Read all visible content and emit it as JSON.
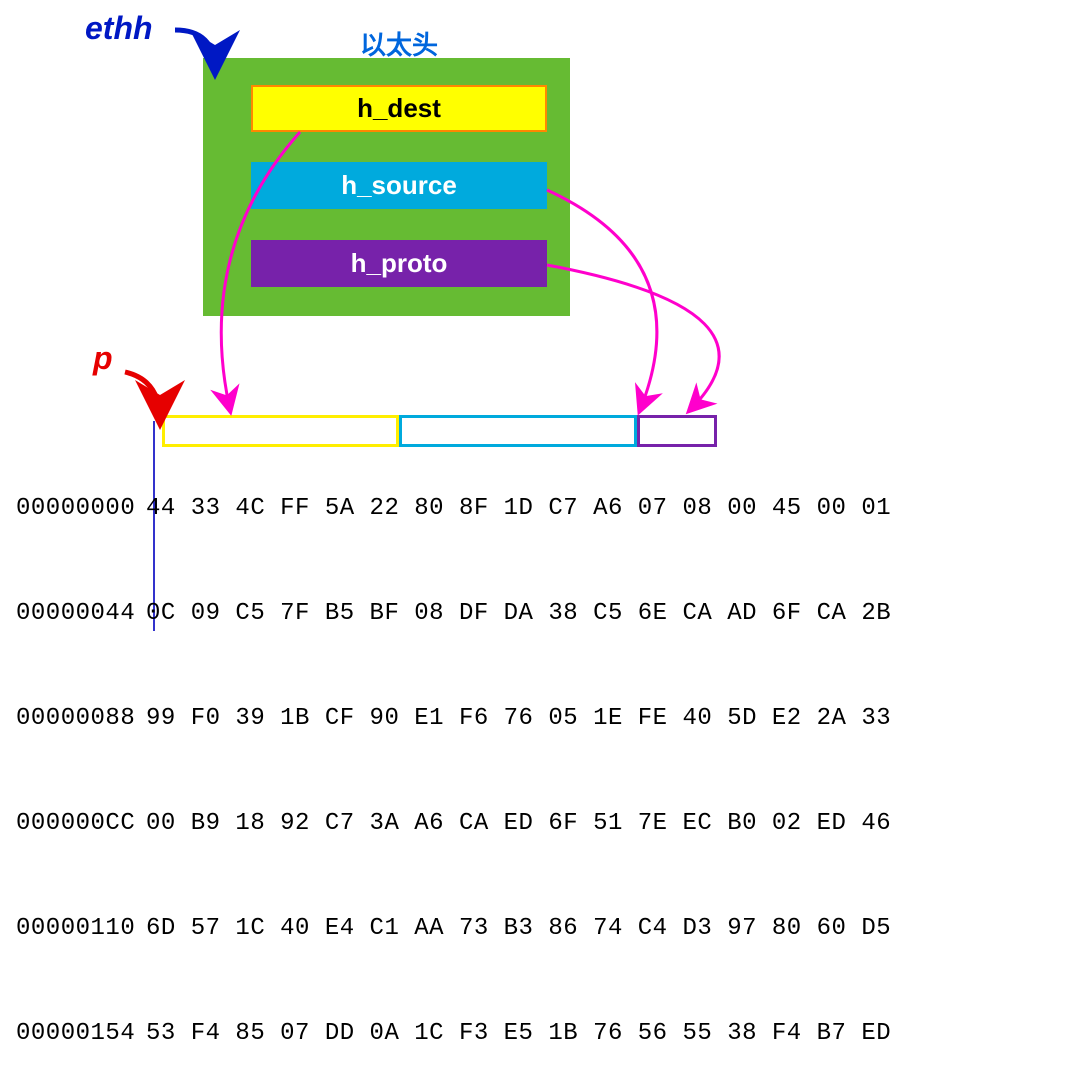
{
  "labels": {
    "ethh": "ethh",
    "p": "p",
    "title": "以太头"
  },
  "fields": {
    "dest": "h_dest",
    "source": "h_source",
    "proto": "h_proto"
  },
  "hexdump": {
    "offsets": [
      "00000000",
      "00000044",
      "00000088",
      "000000CC",
      "00000110",
      "00000154"
    ],
    "rows": [
      "44 33 4C FF 5A 22 80 8F 1D C7 A6 07 08 00 45 00 01",
      "0C 09 C5 7F B5 BF 08 DF DA 38 C5 6E CA AD 6F CA 2B",
      "99 F0 39 1B CF 90 E1 F6 76 05 1E FE 40 5D E2 2A 33",
      "00 B9 18 92 C7 3A A6 CA ED 6F 51 7E EC B0 02 ED 46",
      "6D 57 1C 40 E4 C1 AA 73 B3 86 74 C4 D3 97 80 60 D5",
      "53 F4 85 07 DD 0A 1C F3 E5 1B 76 56 55 38 F4 B7 ED"
    ]
  },
  "highlights": {
    "dest_bytes": "44 33 4C FF 5A 22",
    "source_bytes": "80 8F 1D C7 A6 07",
    "proto_bytes": "08 00"
  },
  "colors": {
    "ethh": "#0018C4",
    "p": "#E60000",
    "struct_bg": "#66BB33",
    "dest": "#FFFF00",
    "source": "#00AADD",
    "proto": "#7722AA",
    "arrow_magenta": "#FF00CC"
  }
}
